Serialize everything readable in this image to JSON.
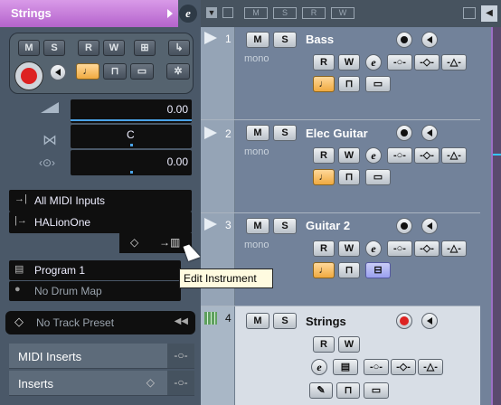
{
  "inspector": {
    "track_name": "Strings",
    "top_buttons": [
      "M",
      "S",
      "R",
      "W"
    ],
    "volume_value": "0.00",
    "pan_value": "C",
    "delay_value": "0.00",
    "midi_input": "All MIDI Inputs",
    "midi_output": "HALionOne",
    "program": "Program 1",
    "drum_map": "No Drum Map",
    "track_preset": "No Track Preset",
    "sections": [
      "MIDI Inserts",
      "Inserts"
    ]
  },
  "tooltip": "Edit Instrument",
  "tracks": [
    {
      "number": "1",
      "name": "Bass",
      "mode": "mono",
      "m": "M",
      "s": "S",
      "r": "R",
      "w": "W"
    },
    {
      "number": "2",
      "name": "Elec Guitar",
      "mode": "mono",
      "m": "M",
      "s": "S",
      "r": "R",
      "w": "W"
    },
    {
      "number": "3",
      "name": "Guitar 2",
      "mode": "mono",
      "m": "M",
      "s": "S",
      "r": "R",
      "w": "W"
    },
    {
      "number": "4",
      "name": "Strings",
      "m": "M",
      "s": "S",
      "r": "R",
      "w": "W"
    }
  ],
  "colors": {
    "accent_purple": "#c472d9",
    "record_red": "#dd2222",
    "selected_track": "#d8dee6",
    "edit_orange": "#f0aa40"
  }
}
